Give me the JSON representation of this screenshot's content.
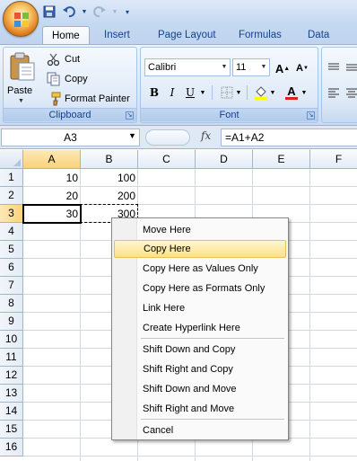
{
  "qat": {
    "icons": [
      "save-icon",
      "undo-icon",
      "redo-icon",
      "customize-qat-icon"
    ]
  },
  "ribbon_tabs": [
    "Home",
    "Insert",
    "Page Layout",
    "Formulas",
    "Data"
  ],
  "clipboard": {
    "paste": "Paste",
    "cut": "Cut",
    "copy": "Copy",
    "format_painter": "Format Painter",
    "group_label": "Clipboard"
  },
  "font": {
    "name": "Calibri",
    "size": "11",
    "group_label": "Font",
    "buttons": [
      "B",
      "I",
      "U"
    ]
  },
  "formula_bar": {
    "name_box": "A3",
    "fx": "fx",
    "formula": "=A1+A2"
  },
  "sheet": {
    "columns": [
      "A",
      "B",
      "C",
      "D",
      "E",
      "F"
    ],
    "rows": [
      "1",
      "2",
      "3",
      "4",
      "5",
      "6",
      "7",
      "8",
      "9",
      "10",
      "11",
      "12",
      "13",
      "14",
      "15",
      "16"
    ],
    "cells": {
      "A1": "10",
      "B1": "100",
      "A2": "20",
      "B2": "200",
      "A3": "30",
      "B3": "300"
    },
    "active_cell": "A3"
  },
  "context_menu": {
    "items": [
      "Move Here",
      "Copy Here",
      "Copy Here as Values Only",
      "Copy Here as Formats Only",
      "Link Here",
      "Create Hyperlink Here",
      "Shift Down and Copy",
      "Shift Right and Copy",
      "Shift Down and Move",
      "Shift Right and Move",
      "Cancel"
    ],
    "highlighted": "Copy Here"
  }
}
